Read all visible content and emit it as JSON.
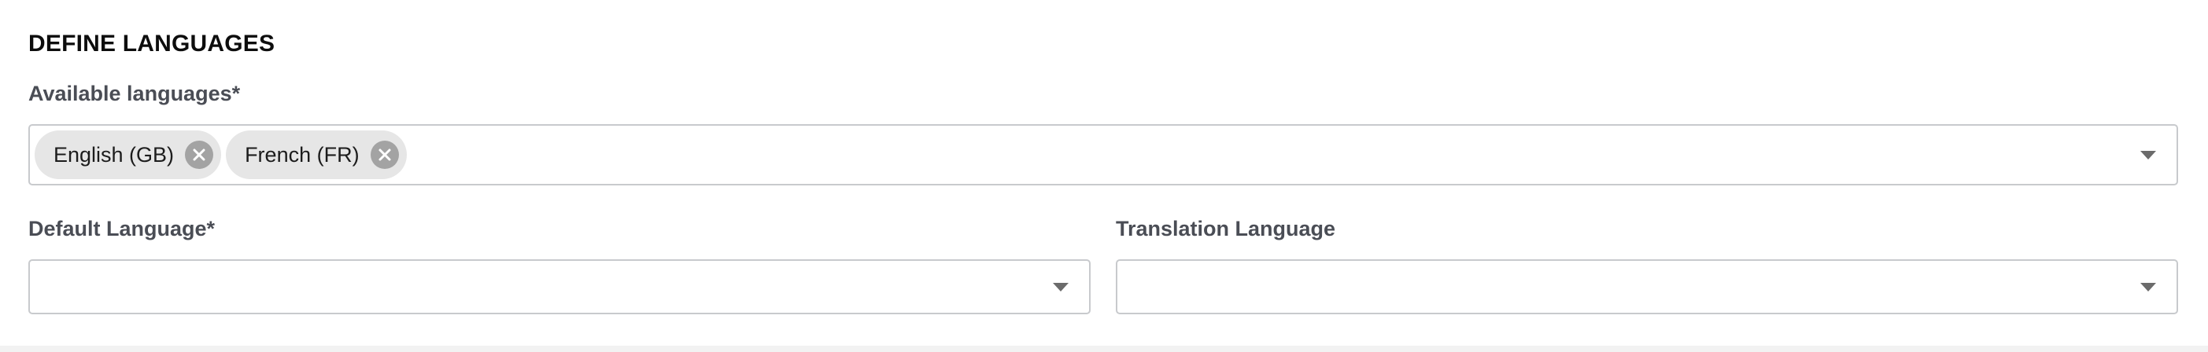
{
  "section": {
    "title": "DEFINE LANGUAGES"
  },
  "available_languages": {
    "label": "Available languages*",
    "selected": [
      {
        "label": "English (GB)"
      },
      {
        "label": "French (FR)"
      }
    ],
    "dropdown_icon": "caret-down-icon",
    "chip_remove_icon": "close-circle-icon"
  },
  "default_language": {
    "label": "Default Language*",
    "value": "",
    "dropdown_icon": "caret-down-icon"
  },
  "translation_language": {
    "label": "Translation Language",
    "value": "",
    "dropdown_icon": "caret-down-icon"
  },
  "colors": {
    "chip_background": "#e6e6e6",
    "chip_remove": "#a3a3a3",
    "label_text": "#4a4d55",
    "border": "#c8cacd"
  }
}
